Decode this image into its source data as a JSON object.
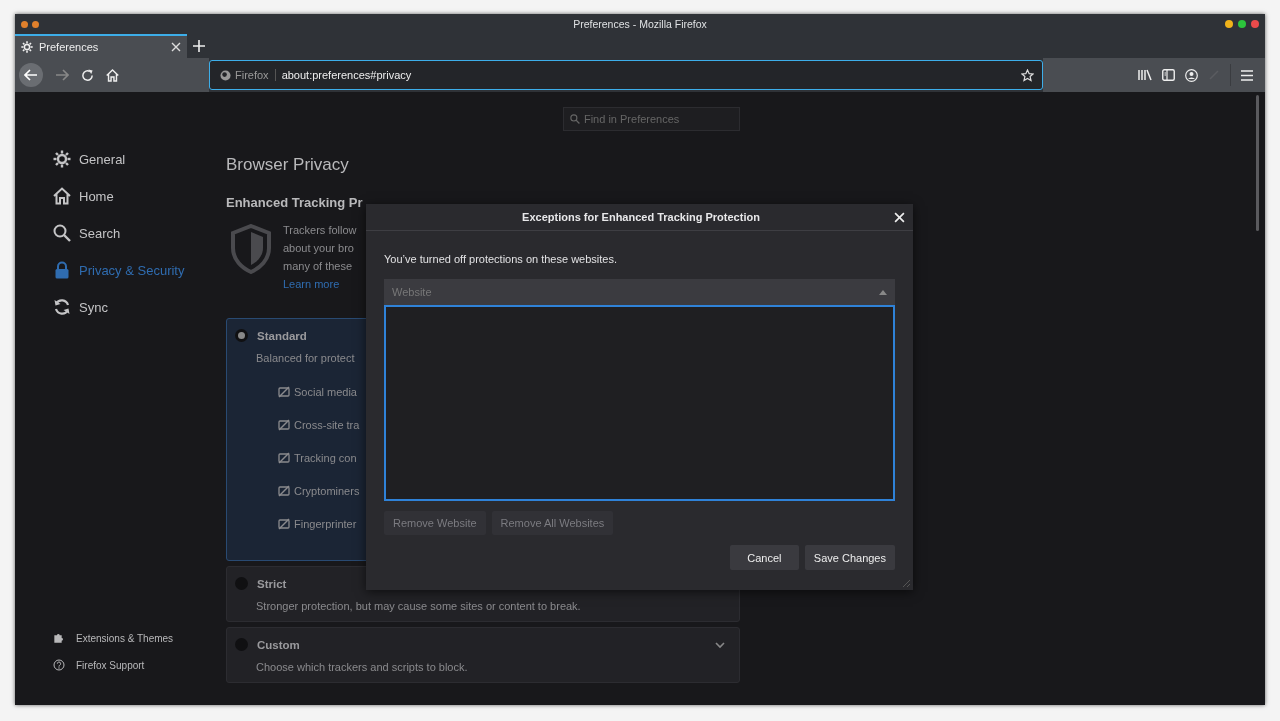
{
  "window": {
    "title": "Preferences - Mozilla Firefox"
  },
  "tabs": [
    {
      "label": "Preferences",
      "selected": true
    }
  ],
  "url_bar": {
    "identity": "Firefox",
    "url": "about:preferences#privacy"
  },
  "search": {
    "placeholder": "Find in Preferences"
  },
  "sidebar": {
    "items": [
      {
        "label": "General",
        "selected": false
      },
      {
        "label": "Home",
        "selected": false
      },
      {
        "label": "Search",
        "selected": false
      },
      {
        "label": "Privacy & Security",
        "selected": true
      },
      {
        "label": "Sync",
        "selected": false
      }
    ],
    "footer_links": [
      "Extensions & Themes",
      "Firefox Support"
    ]
  },
  "main": {
    "heading": "Browser Privacy",
    "section_title": "Enhanced Tracking Pr",
    "description_lines": [
      "Trackers follow",
      "about your bro",
      "many of these"
    ],
    "learn_more": "Learn more",
    "levels": [
      {
        "title": "Standard",
        "description": "Balanced for protect",
        "selected": true,
        "features": [
          "Social media",
          "Cross-site tra",
          "Tracking con",
          "Cryptominers",
          "Fingerprinter"
        ]
      },
      {
        "title": "Strict",
        "description": "Stronger protection, but may cause some sites or content to break.",
        "selected": false
      },
      {
        "title": "Custom",
        "description": "Choose which trackers and scripts to block.",
        "selected": false
      }
    ]
  },
  "dialog": {
    "title": "Exceptions for Enhanced Tracking Protection",
    "intro": "You’ve turned off protections on these websites.",
    "column": "Website",
    "list_buttons": [
      {
        "label": "Remove Website",
        "disabled": true
      },
      {
        "label": "Remove All Websites",
        "disabled": true
      }
    ],
    "buttons": [
      "Cancel",
      "Save Changes"
    ]
  }
}
